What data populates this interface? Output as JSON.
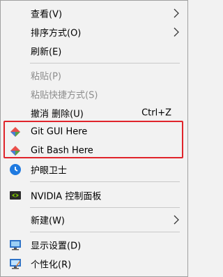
{
  "menu": {
    "view": "查看(V)",
    "sort": "排序方式(O)",
    "refresh": "刷新(E)",
    "paste": "粘贴(P)",
    "paste_shortcut": "粘贴快捷方式(S)",
    "undo": "撤消 删除(U)",
    "undo_shortcut": "Ctrl+Z",
    "git_gui": "Git GUI Here",
    "git_bash": "Git Bash Here",
    "eye_guard": "护眼卫士",
    "nvidia": "NVIDIA 控制面板",
    "new": "新建(W)",
    "display": "显示设置(D)",
    "personalize": "个性化(R)"
  },
  "icons": {
    "git_gui": "git-gui-icon",
    "git_bash": "git-bash-icon",
    "eye_guard": "eye-guard-icon",
    "nvidia": "nvidia-icon",
    "display": "display-settings-icon",
    "personalize": "personalize-icon",
    "submenu": "chevron-right-icon"
  },
  "colors": {
    "highlight_border": "#e0242b",
    "disabled_text": "#8d8d8d",
    "menu_bg": "#f2f2f2"
  }
}
